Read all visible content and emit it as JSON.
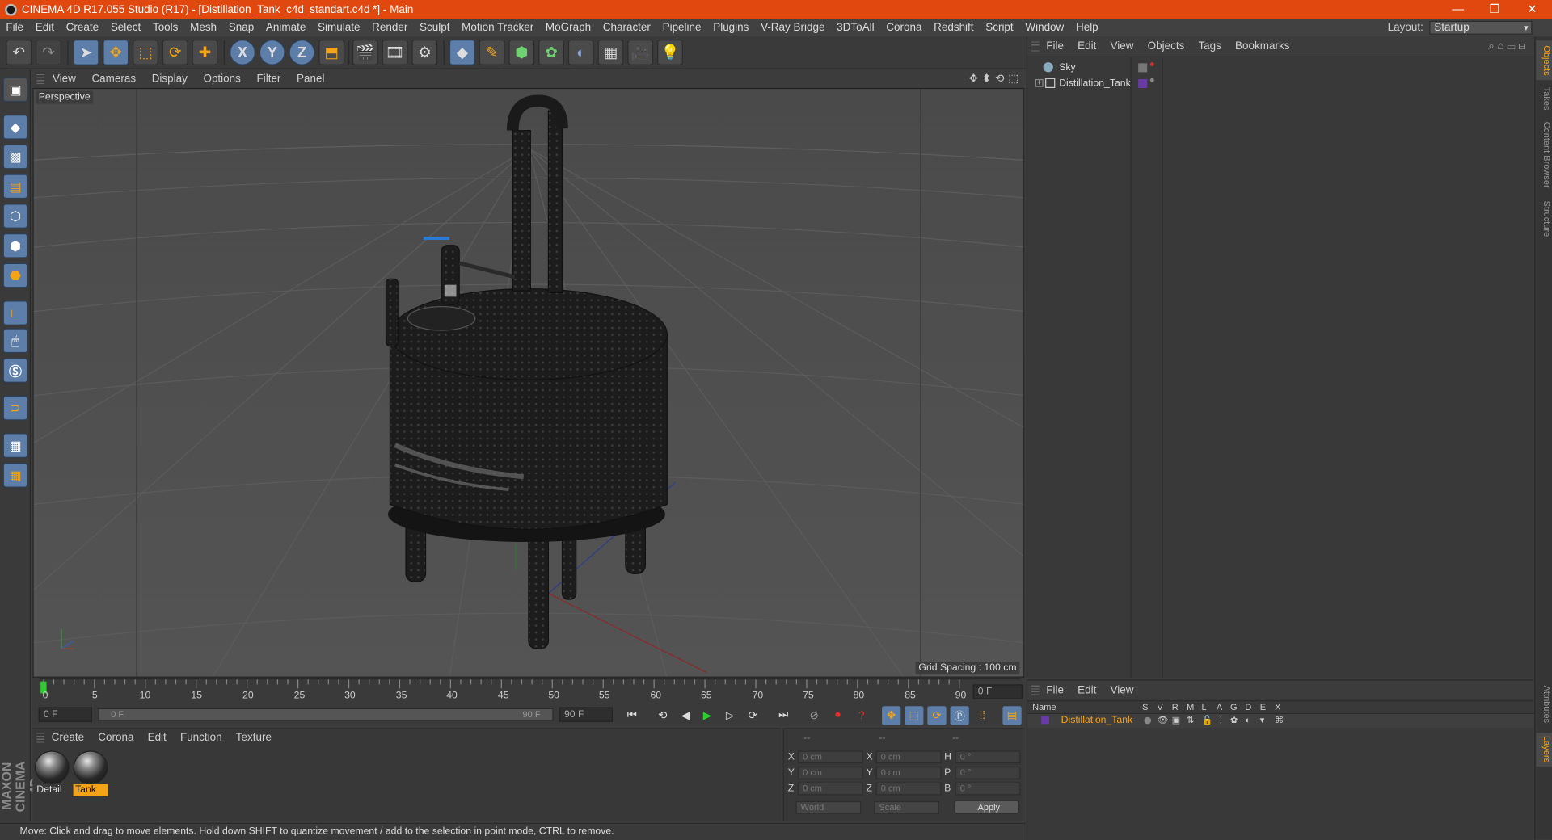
{
  "window": {
    "title": "CINEMA 4D R17.055 Studio (R17) - [Distillation_Tank_c4d_standart.c4d *] - Main",
    "minimize": "—",
    "restore": "❐",
    "close": "✕"
  },
  "menubar": {
    "items": [
      "File",
      "Edit",
      "Create",
      "Select",
      "Tools",
      "Mesh",
      "Snap",
      "Animate",
      "Simulate",
      "Render",
      "Sculpt",
      "Motion Tracker",
      "MoGraph",
      "Character",
      "Pipeline",
      "Plugins",
      "V-Ray Bridge",
      "3DToAll",
      "Corona",
      "Redshift",
      "Script",
      "Window",
      "Help"
    ],
    "layout_label": "Layout:",
    "layout_value": "Startup"
  },
  "toolbar": {
    "icons": [
      "undo-icon",
      "redo-icon",
      "select-arrow-icon",
      "move-icon",
      "scale-icon",
      "rotate-icon",
      "move-plus-icon",
      "x-axis-icon",
      "y-axis-icon",
      "z-axis-icon",
      "coordinate-system-icon",
      "render-view-icon",
      "render-picture-icon",
      "render-settings-icon",
      "cube-primitive-icon",
      "pen-spline-icon",
      "subdivision-icon",
      "cloner-icon",
      "deformer-icon",
      "floor-grid-icon",
      "camera-icon",
      "light-icon"
    ],
    "axis_labels": [
      "X",
      "Y",
      "Z"
    ]
  },
  "viewport": {
    "menu": [
      "View",
      "Cameras",
      "Display",
      "Options",
      "Filter",
      "Panel"
    ],
    "camera_label": "Perspective",
    "grid_spacing": "Grid Spacing : 100 cm",
    "nav_icons": [
      "✥",
      "⬍",
      "⟲",
      "⬚"
    ]
  },
  "timeline": {
    "ticks": [
      "0",
      "5",
      "10",
      "15",
      "20",
      "25",
      "30",
      "35",
      "40",
      "45",
      "50",
      "55",
      "60",
      "65",
      "70",
      "75",
      "80",
      "85",
      "90"
    ],
    "frame_readout": "0 F",
    "start_field": "0 F",
    "range_start": "0 F",
    "range_end": "90 F",
    "end_field": "90 F"
  },
  "materials": {
    "menu": [
      "Create",
      "Corona",
      "Edit",
      "Function",
      "Texture"
    ],
    "items": [
      {
        "name": "Detail",
        "selected": false
      },
      {
        "name": "Tank",
        "selected": true
      }
    ]
  },
  "coordinates": {
    "headers": [
      "--",
      "--",
      "--"
    ],
    "rows": [
      {
        "axis": "X",
        "pos": "0 cm",
        "size_axis": "X",
        "size": "0 cm",
        "rot_axis": "H",
        "rot": "0 °"
      },
      {
        "axis": "Y",
        "pos": "0 cm",
        "size_axis": "Y",
        "size": "0 cm",
        "rot_axis": "P",
        "rot": "0 °"
      },
      {
        "axis": "Z",
        "pos": "0 cm",
        "size_axis": "Z",
        "size": "0 cm",
        "rot_axis": "B",
        "rot": "0 °"
      }
    ],
    "mode": "World",
    "type": "Scale",
    "apply": "Apply"
  },
  "status": "Move: Click and drag to move elements. Hold down SHIFT to quantize movement / add to the selection in point mode, CTRL to remove.",
  "objects": {
    "menu": [
      "File",
      "Edit",
      "View",
      "Objects",
      "Tags",
      "Bookmarks"
    ],
    "items": [
      {
        "name": "Sky"
      },
      {
        "name": "Distillation_Tank"
      }
    ]
  },
  "layers": {
    "menu": [
      "File",
      "Edit",
      "View"
    ],
    "header_name": "Name",
    "columns": [
      "S",
      "V",
      "R",
      "M",
      "L",
      "A",
      "G",
      "D",
      "E",
      "X"
    ],
    "row_name": "Distillation_Tank"
  },
  "side_tabs": [
    "Objects",
    "Takes",
    "Content Browser",
    "Structure",
    "Attributes",
    "Layers"
  ],
  "colors": {
    "titlebar": "#e0480f",
    "accent": "#f6a417",
    "tool_blue": "#5d7ea8"
  }
}
